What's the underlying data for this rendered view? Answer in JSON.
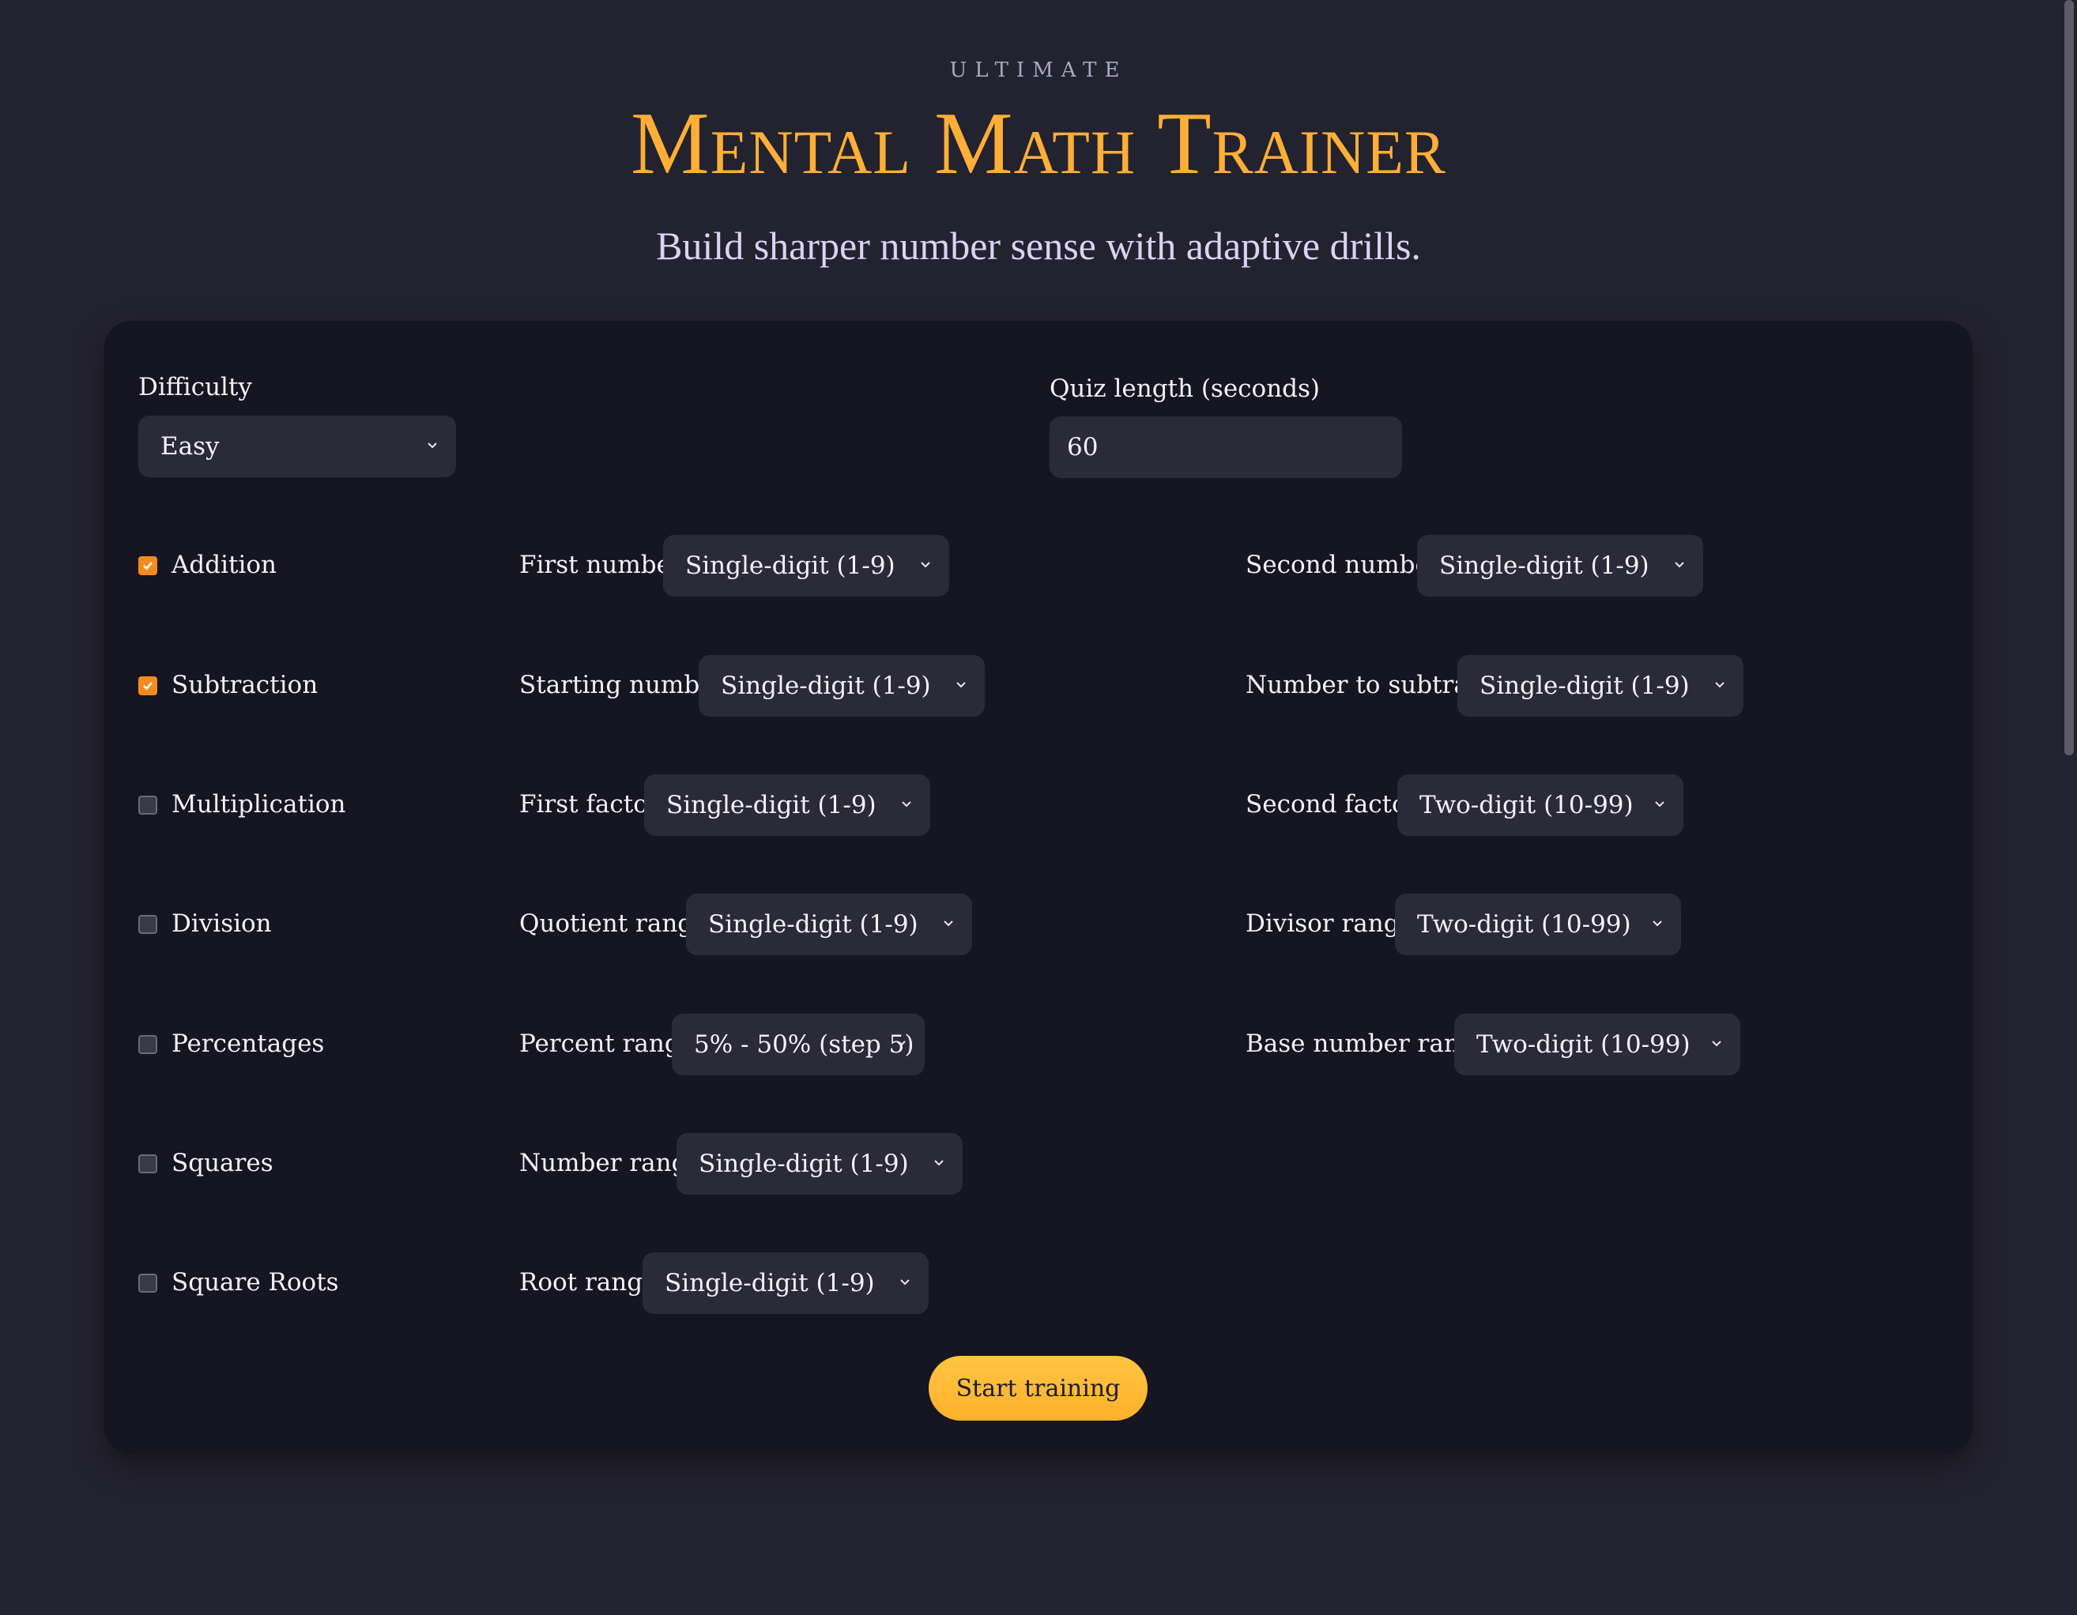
{
  "header": {
    "eyebrow": "ULTIMATE",
    "title": "Mental Math Trainer",
    "subtitle": "Build sharper number sense with adaptive drills."
  },
  "settings": {
    "difficulty_label": "Difficulty",
    "difficulty_value": "Easy",
    "quiz_length_label": "Quiz length (seconds)",
    "quiz_length_value": "60"
  },
  "operations": [
    {
      "name": "Addition",
      "checked": true,
      "first_label": "First number",
      "first_value": "Single-digit (1-9)",
      "second_label": "Second number",
      "second_value": "Single-digit (1-9)"
    },
    {
      "name": "Subtraction",
      "checked": true,
      "first_label": "Starting number",
      "first_value": "Single-digit (1-9)",
      "second_label": "Number to subtract",
      "second_value": "Single-digit (1-9)"
    },
    {
      "name": "Multiplication",
      "checked": false,
      "first_label": "First factor",
      "first_value": "Single-digit (1-9)",
      "second_label": "Second factor",
      "second_value": "Two-digit (10-99)"
    },
    {
      "name": "Division",
      "checked": false,
      "first_label": "Quotient range",
      "first_value": "Single-digit (1-9)",
      "second_label": "Divisor range",
      "second_value": "Two-digit (10-99)"
    },
    {
      "name": "Percentages",
      "checked": false,
      "first_label": "Percent range",
      "first_value": "5% - 50% (step 5)",
      "second_label": "Base number range",
      "second_value": "Two-digit (10-99)"
    },
    {
      "name": "Squares",
      "checked": false,
      "first_label": "Number range",
      "first_value": "Single-digit (1-9)"
    },
    {
      "name": "Square Roots",
      "checked": false,
      "first_label": "Root range",
      "first_value": "Single-digit (1-9)"
    }
  ],
  "actions": {
    "start_label": "Start training"
  },
  "colors": {
    "accent": "#ffae37",
    "checkbox": "#f58a1f",
    "background": "#23222f",
    "card": "#161522"
  }
}
